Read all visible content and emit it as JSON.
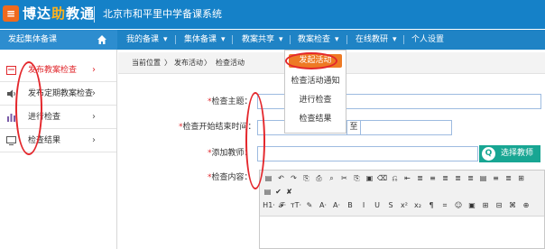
{
  "header": {
    "logo_glyph": "≡",
    "logo_part1": "博达",
    "logo_part2": "助",
    "logo_part3": "教通",
    "system_name": "北京市和平里中学备课系统"
  },
  "navbar": {
    "left_title": "发起集体备课",
    "items": [
      "我的备课",
      "集体备课",
      "教案共享",
      "教案检查",
      "在线教研",
      "个人设置"
    ],
    "chevron": "▾"
  },
  "sidebar": {
    "items": [
      {
        "label": "发布教案检查",
        "arrow": "›",
        "active": true
      },
      {
        "label": "发布定期教案检查",
        "arrow": "›"
      },
      {
        "label": "进行检查",
        "arrow": "›"
      },
      {
        "label": "检查结果",
        "arrow": "›"
      }
    ]
  },
  "breadcrumb": {
    "prefix": "当前位置",
    "sep": "〉",
    "level1": "发布活动",
    "level2": "检查活动"
  },
  "form": {
    "required_mark": "*",
    "title_label": "检查主题：",
    "time_label": "检查开始结束时间：",
    "to_text": "至",
    "teacher_label": "添加教师：",
    "content_label": "检查内容：",
    "select_button": "选择教师",
    "select_icon": "Q"
  },
  "dropdown": {
    "items": [
      "发起活动",
      "检查活动通知",
      "进行检查",
      "检查结果"
    ]
  },
  "toolbar": {
    "row1": [
      "▤",
      "↶",
      "↷",
      "⎘",
      "⎙",
      "⌕",
      "✂",
      "⎘",
      "▣",
      "⌫",
      "⎌",
      "⇤",
      "≣",
      "≡",
      "≣",
      "≣",
      "≣",
      "▤",
      "≡",
      "≣",
      "⊞"
    ],
    "row2": [
      "▤",
      "✔",
      "✘"
    ],
    "row3": [
      "H1·",
      "𝓕·",
      "ᴛT·",
      "✎",
      "A·",
      "A·",
      "B",
      "I",
      "U",
      "S",
      "x²",
      "x₂",
      "¶",
      "⌗",
      "☺",
      "▣",
      "⊞",
      "⊟",
      "⌘",
      "⊕"
    ]
  },
  "colors": {
    "header_bg": "#1581c8",
    "accent_orange": "#ee7a24",
    "select_button_bg": "#18a693",
    "active_red": "#e0282d",
    "annotation_red": "#e4272c"
  }
}
